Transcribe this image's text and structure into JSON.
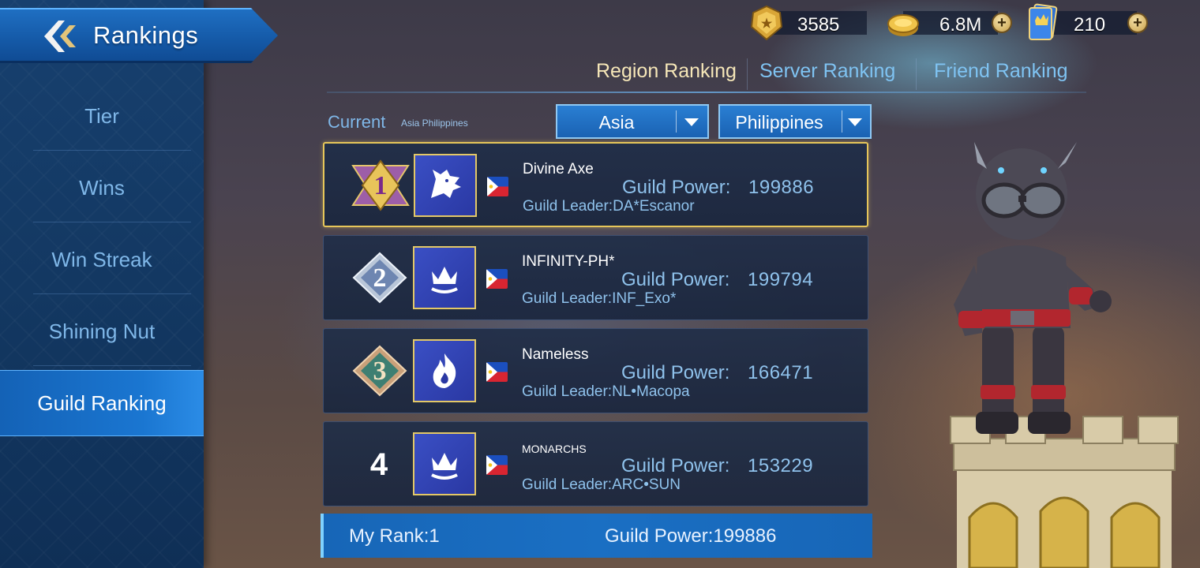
{
  "header": {
    "title": "Rankings",
    "back_icon": "back-arrow-icon"
  },
  "sidebar": {
    "items": [
      {
        "label": "Tier",
        "active": false
      },
      {
        "label": "Wins",
        "active": false
      },
      {
        "label": "Win Streak",
        "active": false
      },
      {
        "label": "Shining Nut",
        "active": false
      },
      {
        "label": "Guild Ranking",
        "active": true
      }
    ]
  },
  "currencies": [
    {
      "icon": "gold-crest-icon",
      "value": "3585",
      "has_plus": false
    },
    {
      "icon": "gold-coin-icon",
      "value": "6.8M",
      "has_plus": true
    },
    {
      "icon": "ticket-card-icon",
      "value": "210",
      "has_plus": true
    }
  ],
  "tabs": [
    {
      "label": "Region Ranking",
      "active": true
    },
    {
      "label": "Server Ranking",
      "active": false
    },
    {
      "label": "Friend Ranking",
      "active": false
    }
  ],
  "filter": {
    "current_label": "Current",
    "current_value": "Asia Philippines",
    "region": "Asia",
    "country": "Philippines"
  },
  "rows": [
    {
      "rank": "1",
      "name": "Divine Axe",
      "power_label": "Guild Power:",
      "power": "199886",
      "leader": "Guild Leader:DA*Escanor",
      "emblem": "wolf-emblem-icon"
    },
    {
      "rank": "2",
      "name": "INFINITY-PH*",
      "power_label": "Guild Power:",
      "power": "199794",
      "leader": "Guild Leader:INF_Exo*",
      "emblem": "crown-emblem-icon"
    },
    {
      "rank": "3",
      "name": "Nameless",
      "power_label": "Guild Power:",
      "power": "166471",
      "leader": "Guild Leader:NL•Macopa",
      "emblem": "flame-emblem-icon"
    },
    {
      "rank": "4",
      "name": "MONARCHS",
      "power_label": "Guild Power:",
      "power": "153229",
      "leader": "Guild Leader:ARC•SUN",
      "emblem": "crown-emblem-icon"
    }
  ],
  "my_rank": {
    "label": "My Rank:1",
    "power": "Guild Power:199886"
  },
  "colors": {
    "accent_gold": "#e6c65a",
    "nav_active": "#1a76d1",
    "text_blue": "#8fc2ec"
  }
}
